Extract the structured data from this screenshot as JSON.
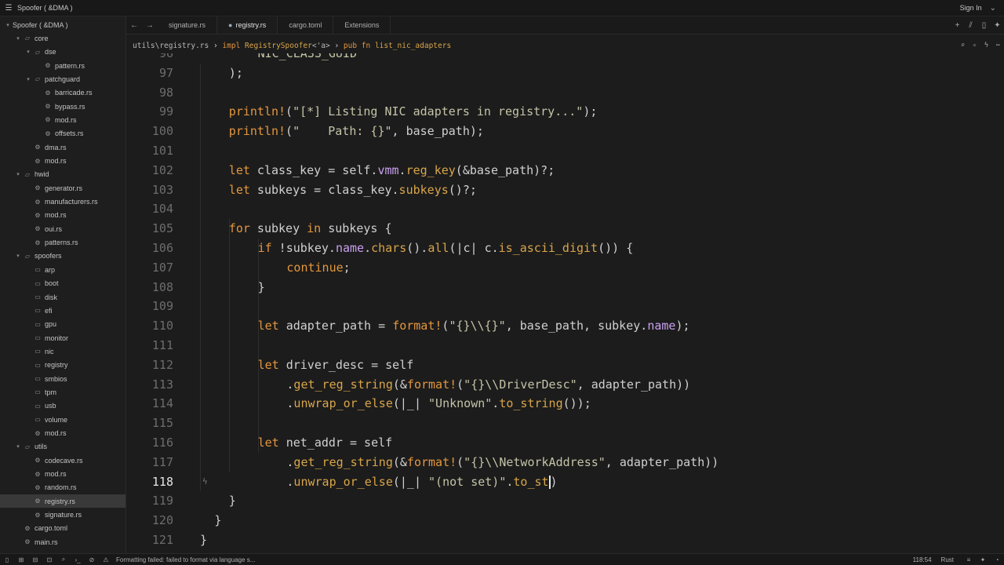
{
  "window": {
    "title": "Spoofer ( &DMA )",
    "sign_in": "Sign In"
  },
  "sidebar": {
    "items": [
      {
        "label": "Spoofer ( &DMA )",
        "type": "root",
        "depth": 0
      },
      {
        "label": "core",
        "type": "folder",
        "depth": 1
      },
      {
        "label": "dse",
        "type": "folder",
        "depth": 2
      },
      {
        "label": "pattern.rs",
        "type": "file",
        "depth": 3
      },
      {
        "label": "patchguard",
        "type": "folder",
        "depth": 2
      },
      {
        "label": "barricade.rs",
        "type": "file",
        "depth": 3
      },
      {
        "label": "bypass.rs",
        "type": "file",
        "depth": 3
      },
      {
        "label": "mod.rs",
        "type": "file",
        "depth": 3
      },
      {
        "label": "offsets.rs",
        "type": "file",
        "depth": 3
      },
      {
        "label": "dma.rs",
        "type": "file",
        "depth": 2
      },
      {
        "label": "mod.rs",
        "type": "file",
        "depth": 2
      },
      {
        "label": "hwid",
        "type": "folder",
        "depth": 1
      },
      {
        "label": "generator.rs",
        "type": "file",
        "depth": 2
      },
      {
        "label": "manufacturers.rs",
        "type": "file",
        "depth": 2
      },
      {
        "label": "mod.rs",
        "type": "file",
        "depth": 2
      },
      {
        "label": "oui.rs",
        "type": "file",
        "depth": 2
      },
      {
        "label": "patterns.rs",
        "type": "file",
        "depth": 2
      },
      {
        "label": "spoofers",
        "type": "folder",
        "depth": 1
      },
      {
        "label": "arp",
        "type": "closed-folder",
        "depth": 2
      },
      {
        "label": "boot",
        "type": "closed-folder",
        "depth": 2
      },
      {
        "label": "disk",
        "type": "closed-folder",
        "depth": 2
      },
      {
        "label": "efi",
        "type": "closed-folder",
        "depth": 2
      },
      {
        "label": "gpu",
        "type": "closed-folder",
        "depth": 2
      },
      {
        "label": "monitor",
        "type": "closed-folder",
        "depth": 2
      },
      {
        "label": "nic",
        "type": "closed-folder",
        "depth": 2
      },
      {
        "label": "registry",
        "type": "closed-folder",
        "depth": 2
      },
      {
        "label": "smbios",
        "type": "closed-folder",
        "depth": 2
      },
      {
        "label": "tpm",
        "type": "closed-folder",
        "depth": 2
      },
      {
        "label": "usb",
        "type": "closed-folder",
        "depth": 2
      },
      {
        "label": "volume",
        "type": "closed-folder",
        "depth": 2
      },
      {
        "label": "mod.rs",
        "type": "file",
        "depth": 2
      },
      {
        "label": "utils",
        "type": "folder",
        "depth": 1
      },
      {
        "label": "codecave.rs",
        "type": "file",
        "depth": 2
      },
      {
        "label": "mod.rs",
        "type": "file",
        "depth": 2
      },
      {
        "label": "random.rs",
        "type": "file",
        "depth": 2
      },
      {
        "label": "registry.rs",
        "type": "file",
        "depth": 2,
        "selected": true
      },
      {
        "label": "signature.rs",
        "type": "file",
        "depth": 2
      },
      {
        "label": "cargo.toml",
        "type": "file",
        "depth": 1
      },
      {
        "label": "main.rs",
        "type": "file",
        "depth": 1
      }
    ]
  },
  "tabs": [
    {
      "label": "signature.rs",
      "active": false
    },
    {
      "label": "registry.rs",
      "active": true
    },
    {
      "label": "cargo.toml",
      "active": false
    },
    {
      "label": "Extensions",
      "active": false
    }
  ],
  "breadcrumb": {
    "path": "utils\\registry.rs",
    "impl_kw": "impl",
    "impl_type": "RegistrySpoofer",
    "impl_generic": "<'a>",
    "fn_kw": "pub fn",
    "fn_name": "list_nic_adapters"
  },
  "editor": {
    "current_line": "118",
    "lines": [
      {
        "n": "96",
        "indent": 2,
        "tokens": [
          [
            "s",
            "NIC_CLASS_GUID"
          ]
        ]
      },
      {
        "n": "97",
        "indent": 1,
        "tokens": [
          [
            "o",
            ");"
          ]
        ]
      },
      {
        "n": "98",
        "indent": 0,
        "tokens": []
      },
      {
        "n": "99",
        "indent": 1,
        "tokens": [
          [
            "m",
            "println!"
          ],
          [
            "o",
            "("
          ],
          [
            "s",
            "\"[*] Listing NIC adapters in registry...\""
          ],
          [
            "o",
            ");"
          ]
        ]
      },
      {
        "n": "100",
        "indent": 1,
        "tokens": [
          [
            "m",
            "println!"
          ],
          [
            "o",
            "("
          ],
          [
            "s",
            "\"    Path: {}\""
          ],
          [
            "o",
            ", base_path);"
          ]
        ]
      },
      {
        "n": "101",
        "indent": 0,
        "tokens": []
      },
      {
        "n": "102",
        "indent": 1,
        "tokens": [
          [
            "k",
            "let"
          ],
          [
            "o",
            " class_key = self."
          ],
          [
            "p",
            "vmm"
          ],
          [
            "o",
            "."
          ],
          [
            "f",
            "reg_key"
          ],
          [
            "o",
            "(&base_path)?;"
          ]
        ]
      },
      {
        "n": "103",
        "indent": 1,
        "tokens": [
          [
            "k",
            "let"
          ],
          [
            "o",
            " subkeys = class_key."
          ],
          [
            "f",
            "subkeys"
          ],
          [
            "o",
            "()?;"
          ]
        ]
      },
      {
        "n": "104",
        "indent": 0,
        "tokens": []
      },
      {
        "n": "105",
        "indent": 1,
        "tokens": [
          [
            "k",
            "for"
          ],
          [
            "o",
            " subkey "
          ],
          [
            "k",
            "in"
          ],
          [
            "o",
            " subkeys {"
          ]
        ]
      },
      {
        "n": "106",
        "indent": 2,
        "tokens": [
          [
            "k",
            "if"
          ],
          [
            "o",
            " !subkey."
          ],
          [
            "p",
            "name"
          ],
          [
            "o",
            "."
          ],
          [
            "f",
            "chars"
          ],
          [
            "o",
            "()."
          ],
          [
            "f",
            "all"
          ],
          [
            "o",
            "(|c| c."
          ],
          [
            "f",
            "is_ascii_digit"
          ],
          [
            "o",
            "()) {"
          ]
        ]
      },
      {
        "n": "107",
        "indent": 3,
        "tokens": [
          [
            "k",
            "continue"
          ],
          [
            "o",
            ";"
          ]
        ]
      },
      {
        "n": "108",
        "indent": 2,
        "tokens": [
          [
            "o",
            "}"
          ]
        ]
      },
      {
        "n": "109",
        "indent": 0,
        "tokens": []
      },
      {
        "n": "110",
        "indent": 2,
        "tokens": [
          [
            "k",
            "let"
          ],
          [
            "o",
            " adapter_path = "
          ],
          [
            "m",
            "format!"
          ],
          [
            "o",
            "("
          ],
          [
            "s",
            "\"{}\\\\{}\""
          ],
          [
            "o",
            ", base_path, subkey."
          ],
          [
            "p",
            "name"
          ],
          [
            "o",
            ");"
          ]
        ]
      },
      {
        "n": "111",
        "indent": 0,
        "tokens": []
      },
      {
        "n": "112",
        "indent": 2,
        "tokens": [
          [
            "k",
            "let"
          ],
          [
            "o",
            " driver_desc = self"
          ]
        ]
      },
      {
        "n": "113",
        "indent": 3,
        "tokens": [
          [
            "o",
            "."
          ],
          [
            "f",
            "get_reg_string"
          ],
          [
            "o",
            "(&"
          ],
          [
            "m",
            "format!"
          ],
          [
            "o",
            "("
          ],
          [
            "s",
            "\"{}\\\\DriverDesc\""
          ],
          [
            "o",
            ", adapter_path))"
          ]
        ]
      },
      {
        "n": "114",
        "indent": 3,
        "tokens": [
          [
            "o",
            "."
          ],
          [
            "f",
            "unwrap_or_else"
          ],
          [
            "o",
            "(|_| "
          ],
          [
            "s",
            "\"Unknown\""
          ],
          [
            "o",
            "."
          ],
          [
            "f",
            "to_string"
          ],
          [
            "o",
            "());"
          ]
        ]
      },
      {
        "n": "115",
        "indent": 0,
        "tokens": []
      },
      {
        "n": "116",
        "indent": 2,
        "tokens": [
          [
            "k",
            "let"
          ],
          [
            "o",
            " net_addr = self"
          ]
        ]
      },
      {
        "n": "117",
        "indent": 3,
        "tokens": [
          [
            "o",
            "."
          ],
          [
            "f",
            "get_reg_string"
          ],
          [
            "o",
            "(&"
          ],
          [
            "m",
            "format!"
          ],
          [
            "o",
            "("
          ],
          [
            "s",
            "\"{}\\\\NetworkAddress\""
          ],
          [
            "o",
            ", adapter_path))"
          ]
        ]
      },
      {
        "n": "118",
        "indent": 3,
        "tokens": [
          [
            "o",
            "."
          ],
          [
            "f",
            "unwrap_or_else"
          ],
          [
            "o",
            "(|_| "
          ],
          [
            "s",
            "\"(not set)\""
          ],
          [
            "o",
            "."
          ],
          [
            "f",
            "to_st"
          ],
          [
            "cursor",
            ""
          ],
          [
            "o",
            ")"
          ]
        ]
      },
      {
        "n": "119",
        "indent": 1,
        "tokens": [
          [
            "o",
            "}"
          ]
        ]
      },
      {
        "n": "120",
        "indent": 0.5,
        "tokens": [
          [
            "o",
            "}"
          ]
        ]
      },
      {
        "n": "121",
        "indent": 0,
        "tokens": [
          [
            "o",
            "}"
          ]
        ]
      }
    ]
  },
  "statusbar": {
    "message": "Formatting failed: failed to format via language s...",
    "position": "118:54",
    "language": "Rust"
  },
  "colors": {
    "keyword": "#e3963e",
    "function": "#d8a54a",
    "string": "#c4c4a8",
    "property": "#c9a0f0",
    "background": "#1c1c1c"
  }
}
